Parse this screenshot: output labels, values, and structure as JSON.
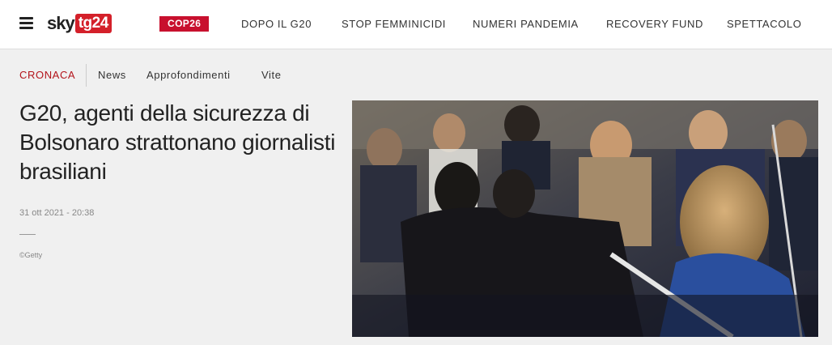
{
  "header": {
    "logo_sky": "sky",
    "logo_tg": "tg24",
    "badge": "COP26",
    "nav": [
      "DOPO IL G20",
      "STOP FEMMINICIDI",
      "NUMERI PANDEMIA",
      "RECOVERY FUND",
      "SPETTACOLO"
    ]
  },
  "subnav": {
    "section": "CRONACA",
    "items": [
      "News",
      "Approfondimenti",
      "Vite"
    ]
  },
  "article": {
    "title": "G20, agenti della sicurezza di Bolsonaro strattonano giornalisti brasiliani",
    "date": "31 ott 2021 - 20:38",
    "credit": "©Getty"
  },
  "colors": {
    "brand_red": "#d4202a",
    "section_red": "#b3141b"
  }
}
